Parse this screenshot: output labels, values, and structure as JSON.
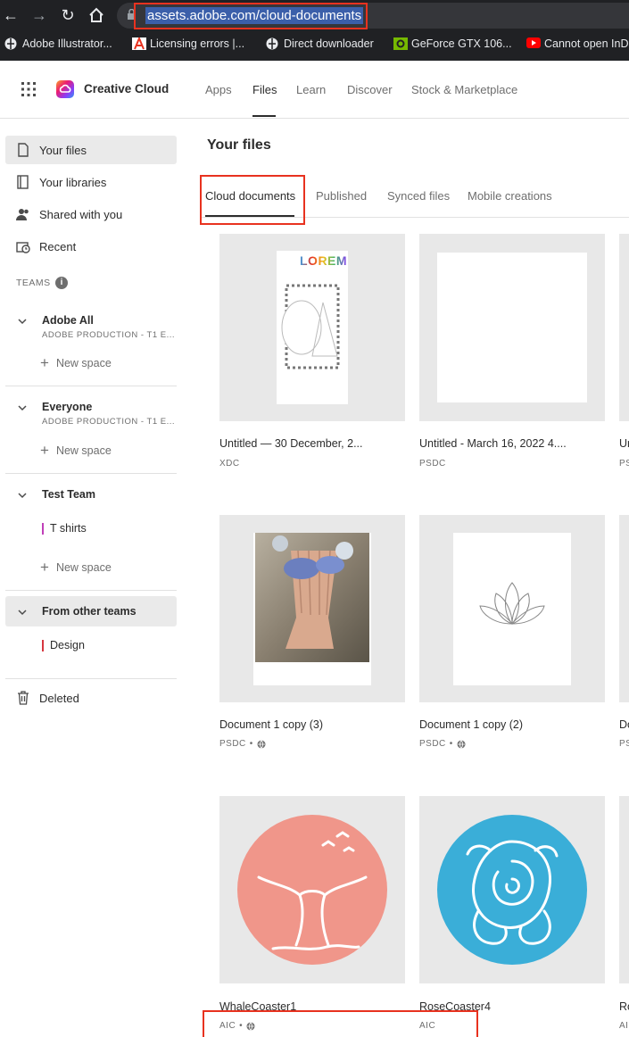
{
  "browser": {
    "url": "assets.adobe.com/cloud-documents",
    "bookmarks": [
      {
        "label": "Adobe Illustrator...",
        "icon": "web-icon"
      },
      {
        "label": "Licensing errors |...",
        "icon": "adobe-icon"
      },
      {
        "label": "Direct downloader",
        "icon": "web-icon"
      },
      {
        "label": "GeForce GTX 106...",
        "icon": "nvidia-icon"
      },
      {
        "label": "Cannot open InD",
        "icon": "youtube-icon"
      }
    ]
  },
  "header": {
    "brand": "Creative Cloud",
    "nav": [
      "Apps",
      "Files",
      "Learn",
      "Discover",
      "Stock & Marketplace"
    ],
    "active_nav": "Files"
  },
  "sidebar": {
    "items": [
      {
        "label": "Your files",
        "icon": "document-icon",
        "selected": true
      },
      {
        "label": "Your libraries",
        "icon": "library-icon"
      },
      {
        "label": "Shared with you",
        "icon": "people-icon"
      },
      {
        "label": "Recent",
        "icon": "recent-icon"
      }
    ],
    "teams_label": "TEAMS",
    "teams": [
      {
        "name": "Adobe All",
        "sub": "ADOBE PRODUCTION - T1 E...",
        "new_space": "New space"
      },
      {
        "name": "Everyone",
        "sub": "ADOBE PRODUCTION - T1 E...",
        "new_space": "New space"
      },
      {
        "name": "Test Team",
        "spaces": [
          {
            "label": "T shirts",
            "color": "#c03fb8"
          }
        ],
        "new_space": "New space"
      },
      {
        "name": "From other teams",
        "spaces": [
          {
            "label": "Design",
            "color": "#d7373f"
          }
        ]
      }
    ],
    "deleted": "Deleted"
  },
  "main": {
    "title": "Your files",
    "tabs": [
      "Cloud documents",
      "Published",
      "Synced files",
      "Mobile creations"
    ],
    "active_tab": "Cloud documents",
    "files": [
      {
        "title": "Untitled — 30 December, 2...",
        "meta": "XDC",
        "shared": false
      },
      {
        "title": "Untitled - March 16, 2022 4....",
        "meta": "PSDC",
        "shared": false
      },
      {
        "title": "Document 1 copy (3)",
        "meta": "PSDC",
        "shared": true
      },
      {
        "title": "Document 1 copy (2)",
        "meta": "PSDC",
        "shared": true
      },
      {
        "title": "WhaleCoaster1",
        "meta": "AIC",
        "shared": true
      },
      {
        "title": "RoseCoaster4",
        "meta": "AIC",
        "shared": false
      }
    ],
    "partial_column": {
      "titles": [
        "Ur",
        "Do",
        "Ro"
      ],
      "metas": [
        "PS",
        "PS",
        "AIC"
      ]
    },
    "thumb_text": "LOREM"
  },
  "colors": {
    "highlight": "#e8321f",
    "whale_bg": "#f0968a",
    "rose_bg": "#3aaed8",
    "accent_tshirts": "#c03fb8",
    "accent_design": "#d7373f"
  }
}
